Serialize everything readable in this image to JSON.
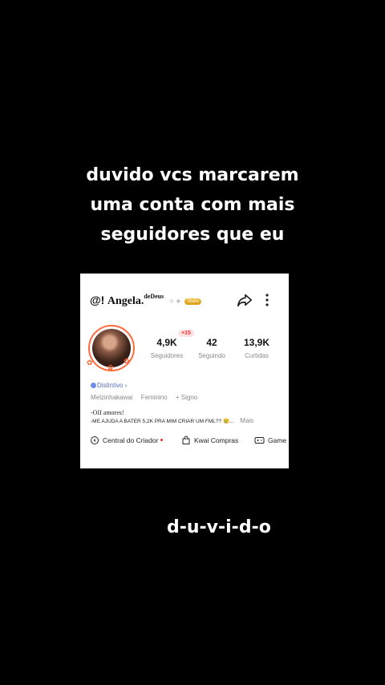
{
  "caption": {
    "lines": [
      "duvido vcs marcarem",
      "uma conta com mais",
      "seguidores que eu"
    ]
  },
  "profile": {
    "at_prefix": "@!",
    "name": "Angela.",
    "name_sup": "deDeus",
    "wings_icon": "wings-icon",
    "badge_text": "Ouro",
    "stats_badge": "+15",
    "stats": [
      {
        "value": "4,9K",
        "label": "Seguidores"
      },
      {
        "value": "42",
        "label": "Seguindo"
      },
      {
        "value": "13,9K",
        "label": "Curtidas"
      }
    ],
    "distintivo": "Distintivo ›",
    "tags": [
      "Melzinhakawai",
      "Feminino",
      "+ Signo"
    ],
    "bio_line1": "-OII amores!",
    "bio_line2": "-ME AJUDA A BATER 5,2K PRA MIM CRIAR UM FML?? 😢...",
    "bio_more": "Mais",
    "actions": [
      {
        "label": "Central do Criador",
        "icon": "creator-center-icon"
      },
      {
        "label": "Kwai Compras",
        "icon": "shopping-bag-icon"
      },
      {
        "label": "Game",
        "icon": "gamepad-icon"
      }
    ],
    "colors": {
      "accent": "#ff6b3d",
      "badge_gold": "#e0a520",
      "alert_red": "#e83030",
      "distintivo_blue": "#5b6fc0"
    }
  },
  "bottom_text": "d-u-v-i-d-o"
}
